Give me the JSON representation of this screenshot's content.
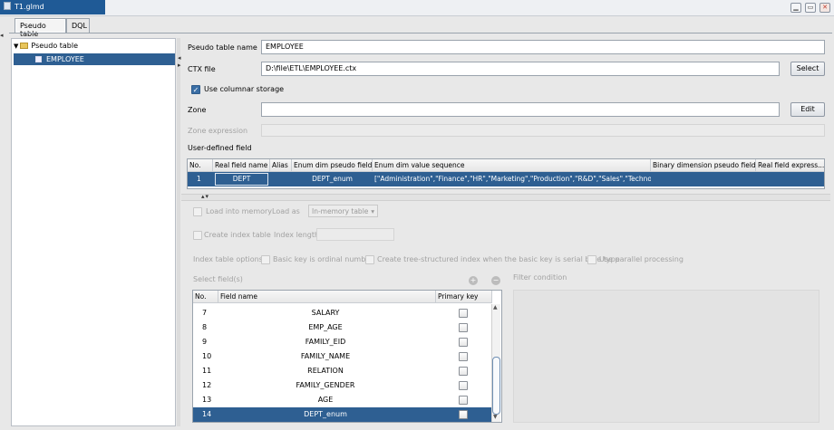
{
  "window": {
    "title": "T1.glmd"
  },
  "tabs": [
    {
      "label": "Pseudo table"
    },
    {
      "label": "DQL"
    }
  ],
  "tree": {
    "root_label": "Pseudo table",
    "selected_label": "EMPLOYEE"
  },
  "form": {
    "name_label": "Pseudo table name",
    "name_value": "EMPLOYEE",
    "ctx_label": "CTX file",
    "ctx_value": "D:\\file\\ETL\\EMPLOYEE.ctx",
    "select_btn": "Select",
    "columnar_label": "Use columnar storage",
    "zone_label": "Zone",
    "zone_value": "",
    "edit_btn": "Edit",
    "zone_expr_label": "Zone expression",
    "udf_label": "User-defined field"
  },
  "udf_table": {
    "headers": [
      "No.",
      "Real field name",
      "Alias",
      "Enum dim pseudo field",
      "Enum dim value sequence",
      "Binary dimension pseudo field",
      "Real field express..."
    ],
    "rows": [
      {
        "no": "1",
        "real": "DEPT",
        "alias": "",
        "enum_field": "DEPT_enum",
        "enum_seq": "[\"Administration\",\"Finance\",\"HR\",\"Marketing\",\"Production\",\"R&D\",\"Sales\",\"Technology\"]",
        "binary": "",
        "expr": ""
      }
    ]
  },
  "options": {
    "load_memory": "Load into memory",
    "load_as": "Load as",
    "load_as_value": "In-memory table",
    "create_index": "Create index table",
    "index_length": "Index length",
    "index_options": "Index table options:",
    "opt_ordinal": "Basic key is ordinal number",
    "opt_tree": "Create tree-structured index when the basic key is serial byte type",
    "opt_parallel": "Use parallel processing",
    "select_fields": "Select field(s)",
    "filter_condition": "Filter condition"
  },
  "fields_table": {
    "headers": [
      "No.",
      "Field name",
      "Primary key"
    ],
    "rows": [
      {
        "no": "7",
        "name": "SALARY"
      },
      {
        "no": "8",
        "name": "EMP_AGE"
      },
      {
        "no": "9",
        "name": "FAMILY_EID"
      },
      {
        "no": "10",
        "name": "FAMILY_NAME"
      },
      {
        "no": "11",
        "name": "RELATION"
      },
      {
        "no": "12",
        "name": "FAMILY_GENDER"
      },
      {
        "no": "13",
        "name": "AGE"
      },
      {
        "no": "14",
        "name": "DEPT_enum"
      }
    ]
  },
  "colors": {
    "selection": "#2e5f92",
    "title_tab": "#1f5a96"
  }
}
